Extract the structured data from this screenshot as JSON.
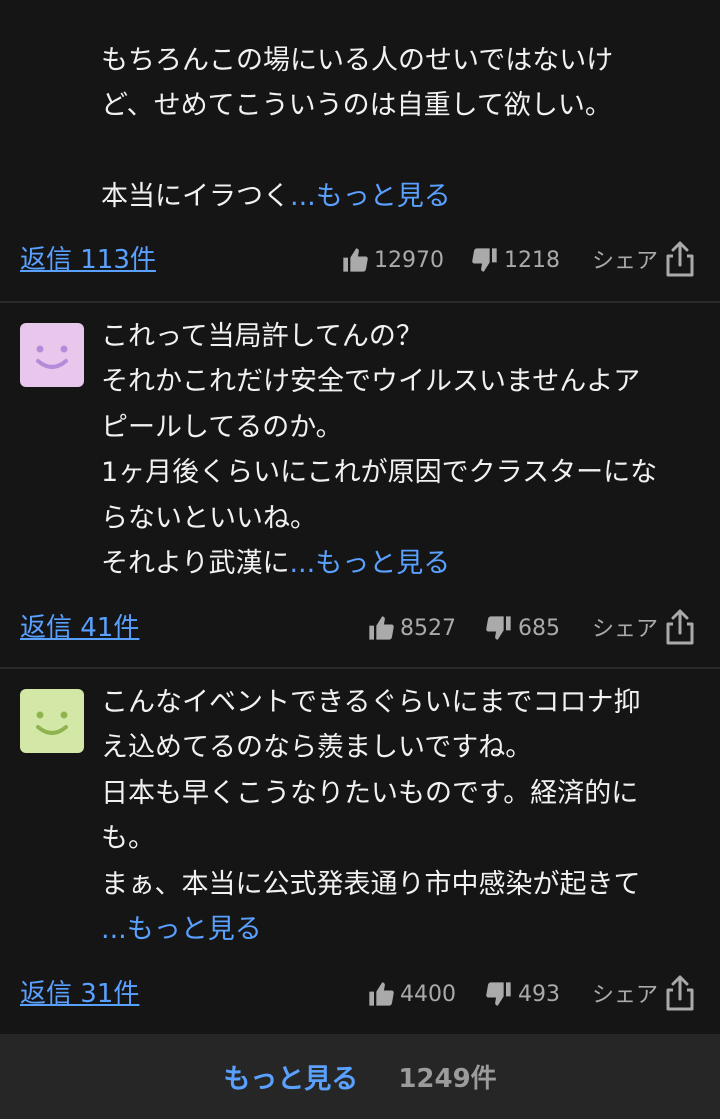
{
  "comments": [
    {
      "text": "もちろんこの場にいる人のせいではないけ\nど、せめてこういうのは自重して欲しい。\n\n本当にイラつく",
      "more": "...もっと見る",
      "reply": "返信 113件",
      "likes": "12970",
      "dislikes": "1218",
      "share": "シェア"
    },
    {
      "avatar_color": "#e8c7ec",
      "avatar_face_color": "#b48bd8",
      "text": "これって当局許してんの？\nそれかこれだけ安全でウイルスいませんよア\nピールしてるのか。\n1ヶ月後くらいにこれが原因でクラスターにな\nらないといいね。\nそれより武漢に",
      "more": "...もっと見る",
      "reply": "返信 41件",
      "likes": "8527",
      "dislikes": "685",
      "share": "シェア"
    },
    {
      "avatar_color": "#d3e8a6",
      "avatar_face_color": "#8fb44f",
      "text": "こんなイベントできるぐらいにまでコロナ抑\nえ込めてるのなら羨ましいですね。\n日本も早くこうなりたいものです。経済的に\nも。\nまぁ、本当に公式発表通り市中感染が起きて\n",
      "more": "...もっと見る",
      "reply": "返信 31件",
      "likes": "4400",
      "dislikes": "493",
      "share": "シェア"
    }
  ],
  "footer": {
    "more_label": "もっと見る",
    "count": "1249件"
  }
}
